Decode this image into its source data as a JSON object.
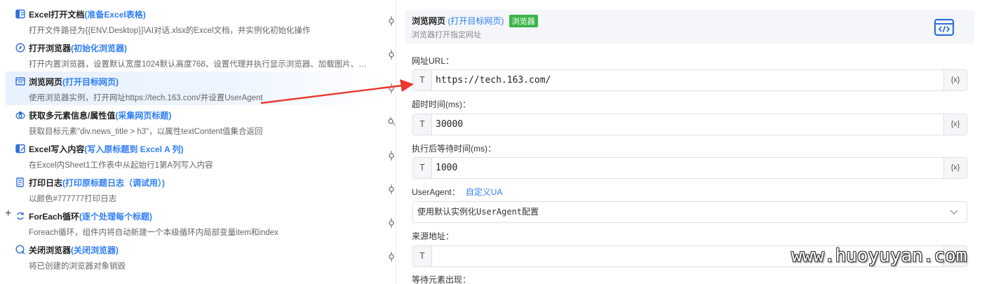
{
  "steps": [
    {
      "title": "Excel打开文档",
      "sub": "(准备Excel表格)",
      "desc": "打开文件路径为{{ENV.Desktop}}\\AI对话.xlsx的Excel文档，并实例化初始化操作",
      "icon": "excel-open-icon"
    },
    {
      "title": "打开浏览器",
      "sub": "(初始化浏览器)",
      "desc": "打开内置浏览器，设置默认宽度1024默认高度768、设置代理并执行显示浏览器、加载图片、…",
      "icon": "browser-icon"
    },
    {
      "title": "浏览网页",
      "sub": "(打开目标网页)",
      "desc": "使用浏览器实例，打开网址https://tech.163.com/并设置UserAgent",
      "icon": "webpage-icon"
    },
    {
      "title": "获取多元素信息/属性值",
      "sub": "(采集网页标题)",
      "desc": "获取目标元素\"div.news_title > h3\"，以属性textContent值集合返回",
      "icon": "collect-icon"
    },
    {
      "title": "Excel写入内容",
      "sub": "(写入原标题到 Excel A 列)",
      "desc": "在Excel内Sheet1工作表中从起始行1第A列写入内容",
      "icon": "excel-write-icon"
    },
    {
      "title": "打印日志",
      "sub": "(打印原标题日志（调试用）)",
      "desc": "以颜色#777777打印日志",
      "icon": "log-icon"
    },
    {
      "title": "ForEach循环",
      "sub": " (逐个处理每个标题)",
      "desc": "Foreach循环，组件内将自动新建一个本级循环内局部变量item和index",
      "icon": "loop-icon"
    },
    {
      "title": "关闭浏览器",
      "sub": "(关闭浏览器)",
      "desc": "将已创建的浏览器对象销毁",
      "icon": "close-browser-icon"
    }
  ],
  "plus_symbol": "+",
  "panel": {
    "title": "浏览网页",
    "subtitle": "(打开目标网页)",
    "badge": "浏览器",
    "hint": "浏览器打开指定网址",
    "url_label": "网址URL：",
    "url_value": "https://tech.163.com/",
    "timeout_label": "超时时间(ms)：",
    "timeout_value": "30000",
    "wait_label": "执行后等待时间(ms)：",
    "wait_value": "1000",
    "ua_label": "UserAgent：",
    "ua_link": "自定义UA",
    "ua_select": "使用默认实例化UserAgent配置",
    "referer_label": "来源地址：",
    "referer_value": "",
    "wait_element_label": "等待元素出现：",
    "type_tag": "T",
    "var_tag": "{x}"
  },
  "watermark": "www.huoyuyan.com",
  "colors": {
    "accent": "#2f7ef5",
    "badge": "#3bb54a",
    "arrow": "#e8392f",
    "selected_bg": "#e8f1fe"
  }
}
